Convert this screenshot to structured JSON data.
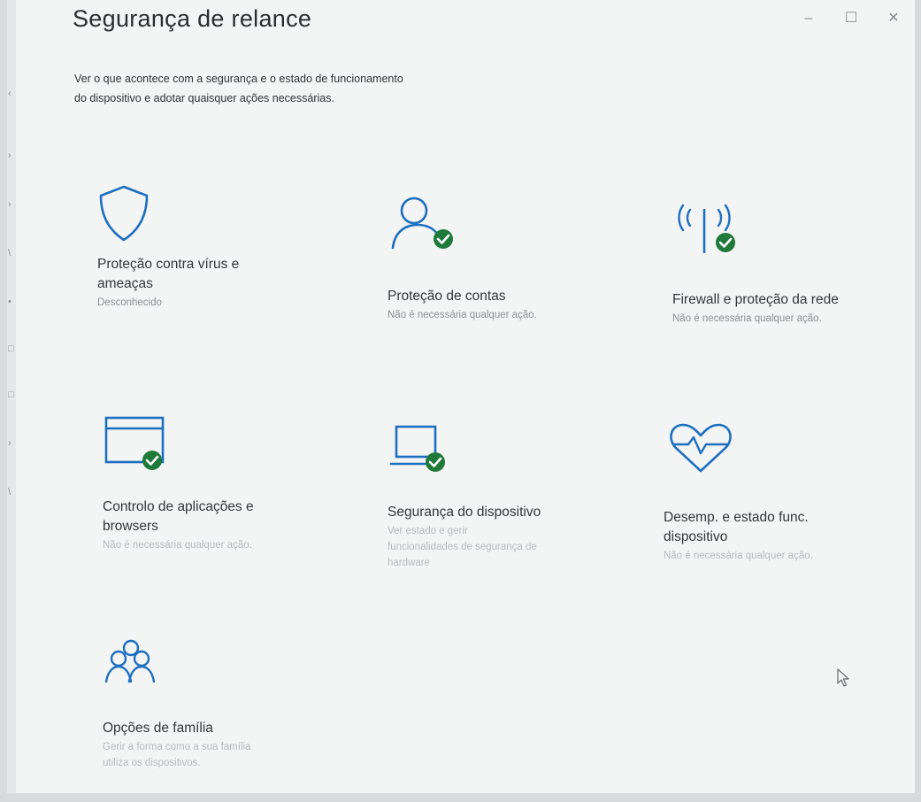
{
  "window": {
    "title": "Segurança de relance",
    "subtitle_lines": [
      "Ver o que acontece com a segurança e o estado de funcionamento",
      "do dispositivo e adotar quaisquer ações necessárias."
    ],
    "controls": {
      "minimize": "–",
      "maximize": "☐",
      "close": "✕"
    }
  },
  "colors": {
    "accent": "#1d6fc0",
    "ok": "#1f7a3a",
    "background": "#f3f4f4"
  },
  "tiles": [
    {
      "icon": "shield-icon",
      "title_lines": [
        "Proteção contra vírus e",
        "ameaças"
      ],
      "status_lines": [
        "Desconhecido"
      ],
      "badge": false
    },
    {
      "icon": "account-icon",
      "title_lines": [
        "Proteção de contas"
      ],
      "status_lines": [
        "Não é necessária qualquer ação."
      ],
      "badge": true
    },
    {
      "icon": "firewall-antenna-icon",
      "title_lines": [
        "Firewall e proteção da rede"
      ],
      "status_lines": [
        "Não é necessária qualquer ação."
      ],
      "badge": true
    },
    {
      "icon": "app-browser-window-icon",
      "title_lines": [
        "Controlo de aplicações e",
        "browsers"
      ],
      "status_lines": [
        "Não é necessária qualquer ação."
      ],
      "badge": true
    },
    {
      "icon": "laptop-icon",
      "title_lines": [
        "Segurança do dispositivo"
      ],
      "status_lines": [
        "Ver estado e gerir",
        "funcionalidades de segurança de",
        "hardware"
      ],
      "badge": true
    },
    {
      "icon": "heart-pulse-icon",
      "title_lines": [
        "Desemp. e estado func.",
        "dispositivo"
      ],
      "status_lines": [
        "Não é necessária qualquer ação."
      ],
      "badge": false
    },
    {
      "icon": "family-icon",
      "title_lines": [
        "Opções de família"
      ],
      "status_lines": [
        "Gerir a forma como a sua família",
        "utiliza os dispositivos."
      ],
      "badge": false
    }
  ]
}
